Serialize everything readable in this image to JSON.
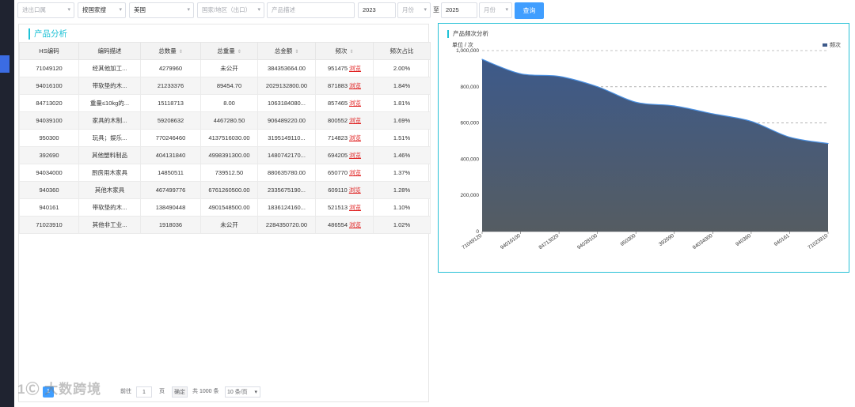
{
  "toolbar": {
    "trade_type": {
      "placeholder": "进出口属",
      "value": ""
    },
    "dimension": {
      "value": "按国家搜"
    },
    "country": {
      "value": "美国"
    },
    "region": {
      "placeholder": "国家/地区（出口）"
    },
    "product_desc": {
      "placeholder": "产品描述"
    },
    "start_year": {
      "value": "2023"
    },
    "start_month": {
      "placeholder": "月份"
    },
    "to_label": "至",
    "end_year": {
      "value": "2025"
    },
    "end_month": {
      "placeholder": "月份"
    },
    "query_label": "查询"
  },
  "panel": {
    "title": "产品分析"
  },
  "table": {
    "headers": [
      "HS编码",
      "编码描述",
      "总数量",
      "总重量",
      "总金额",
      "频次",
      "频次占比"
    ],
    "rows": [
      {
        "hs": "71049120",
        "desc": "经其他加工...",
        "qty": "4279960",
        "weight": "未公开",
        "amount": "384353664.00",
        "freq": "951475",
        "ratio": "2.00%"
      },
      {
        "hs": "94016100",
        "desc": "带软垫的木...",
        "qty": "21233376",
        "weight": "89454.70",
        "amount": "2029132800.00",
        "freq": "871883",
        "ratio": "1.84%"
      },
      {
        "hs": "84713020",
        "desc": "重量≤10kg的...",
        "qty": "15118713",
        "weight": "8.00",
        "amount": "1063184080...",
        "freq": "857465",
        "ratio": "1.81%"
      },
      {
        "hs": "94039100",
        "desc": "家具的木制...",
        "qty": "59208632",
        "weight": "4467280.50",
        "amount": "906489220.00",
        "freq": "800552",
        "ratio": "1.69%"
      },
      {
        "hs": "950300",
        "desc": "玩具；娱乐...",
        "qty": "770246460",
        "weight": "4137516030.00",
        "amount": "3195149110...",
        "freq": "714823",
        "ratio": "1.51%"
      },
      {
        "hs": "392690",
        "desc": "其他塑料制品",
        "qty": "404131840",
        "weight": "4998391300.00",
        "amount": "1480742170...",
        "freq": "694205",
        "ratio": "1.46%"
      },
      {
        "hs": "94034000",
        "desc": "厨房用木家具",
        "qty": "14850511",
        "weight": "739512.50",
        "amount": "880635780.00",
        "freq": "650770",
        "ratio": "1.37%"
      },
      {
        "hs": "940360",
        "desc": "其他木家具",
        "qty": "467499776",
        "weight": "6761260500.00",
        "amount": "2335675190...",
        "freq": "609110",
        "ratio": "1.28%"
      },
      {
        "hs": "940161",
        "desc": "带软垫的木...",
        "qty": "138490448",
        "weight": "4901548500.00",
        "amount": "1836124160...",
        "freq": "521513",
        "ratio": "1.10%"
      },
      {
        "hs": "71023910",
        "desc": "其他非工业...",
        "qty": "1918036",
        "weight": "未公开",
        "amount": "2284350720.00",
        "freq": "486554",
        "ratio": "1.02%"
      }
    ],
    "link_label": "浏览"
  },
  "pagination": {
    "current": "1",
    "goto_prefix": "前往",
    "goto_value": "1",
    "goto_suffix": "页",
    "confirm": "确定",
    "total": "共 1000 条",
    "page_size": "10 条/页"
  },
  "watermark": "1Ⓒ 大数跨境",
  "chart": {
    "title": "产品频次分析",
    "unit": "单位 / 次",
    "legend": "频次",
    "color": "#3d5a8a",
    "line_color": "#4a90e2"
  },
  "chart_data": {
    "type": "area",
    "title": "产品频次分析",
    "ylabel": "单位 / 次",
    "x": [
      "71049120",
      "94016100",
      "84713020",
      "94039100",
      "950300",
      "392690",
      "94034000",
      "940360",
      "940161",
      "71023910"
    ],
    "series": [
      {
        "name": "频次",
        "values": [
          951475,
          871883,
          857465,
          800552,
          714823,
          694205,
          650770,
          609110,
          521513,
          486554
        ]
      }
    ],
    "ylim": [
      0,
      1000000
    ],
    "yticks": [
      "0",
      "200,000",
      "400,000",
      "600,000",
      "800,000",
      "1,000,000"
    ],
    "grid": true,
    "legend_position": "top-right"
  }
}
